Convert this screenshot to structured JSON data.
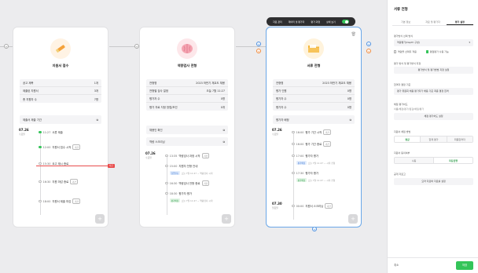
{
  "toolbar": {
    "items": [
      "자료 관리",
      "데이터 및 평가자",
      "평가 과정",
      "상세 보기"
    ],
    "toggle_on": true
  },
  "cards": [
    {
      "title": "지원서 접수",
      "info": [
        {
          "k": "공고 제목",
          "v": "1개"
        },
        {
          "k": "제출된 지원서",
          "v": "3개"
        },
        {
          "k": "총 지원자 수",
          "v": "7명"
        }
      ],
      "button": "제출서 제출 기간",
      "day_date": "07.26",
      "day_wk": "수요일",
      "events": [
        {
          "time": "11:27",
          "text": "서류 제출",
          "tag": "",
          "sub": ""
        },
        {
          "time": "12:00",
          "text": "지원서 접수 시작",
          "tag": "기간",
          "sub": ""
        },
        {
          "time": "15:30",
          "text": "요고 제시 종료",
          "tag": "",
          "sub": ""
        },
        {
          "time": "16:30",
          "text": "지원 마감 종료",
          "tag": "기간",
          "sub": ""
        },
        {
          "time": "18:00",
          "text": "지원서 제출 마감",
          "tag": "기간",
          "sub": ""
        }
      ],
      "red_badge": "지금"
    },
    {
      "title": "역량검사 전형",
      "info": [
        {
          "k": "전형명",
          "v": "2023 하반기 채교도 채용"
        },
        {
          "k": "전형별 검사 일정",
          "v": "오늘 7월 11:27"
        },
        {
          "k": "평가자 수",
          "v": "0명"
        },
        {
          "k": "평가 자료 지정 방법/조건",
          "v": "0개"
        }
      ],
      "buttons": [
        "채용인 확인",
        "역량 스크리닝"
      ],
      "day_date": "07.26",
      "day_wk": "수요일",
      "events": [
        {
          "time": "13:35",
          "text": "역량검사 과정 시작",
          "tag": "기간",
          "tagc": "o",
          "sub": ""
        },
        {
          "time": "15:00",
          "text": "지원자 전형 안내",
          "tag": "",
          "sub": ""
        },
        {
          "time": "",
          "text": "",
          "tag": "영업발표",
          "tagc": "b",
          "sub": "오늘 7월 11:27 ~ 역량검사 시작"
        },
        {
          "time": "16:30",
          "text": "역량검사 전형 종료",
          "tag": "기간",
          "tagc": "o",
          "sub": ""
        },
        {
          "time": "18:30",
          "text": "평가자 평가",
          "tag": "",
          "sub": ""
        },
        {
          "time": "",
          "text": "",
          "tag": "평가배정",
          "tagc": "g",
          "sub": "오늘 7월 11:27 ~ 역량검사 시작"
        }
      ]
    },
    {
      "title": "서류 전형",
      "info": [
        {
          "k": "전형명",
          "v": "2023 하반기 채교도 채용"
        },
        {
          "k": "평가 인원",
          "v": "0명"
        },
        {
          "k": "평가자 수",
          "v": "0명"
        },
        {
          "k": "평가자 수",
          "v": "0명"
        }
      ],
      "button": "평가자 배정",
      "day_date": "07.26",
      "day_wk": "수요일",
      "events": [
        {
          "time": "16:00",
          "text": "평가 기간 시작",
          "tag": "기간",
          "tagc": "o",
          "sub": ""
        },
        {
          "time": "16:00",
          "text": "평가 기간 종료",
          "tag": "기간",
          "tagc": "o",
          "sub": ""
        },
        {
          "time": "17:00",
          "text": "평가자 평가",
          "tag": "",
          "sub": ""
        },
        {
          "time": "",
          "text": "",
          "tag": "평가배정",
          "tagc": "b",
          "sub": "오늘 7월 11:27 ~ 시작 전형"
        },
        {
          "time": "17:30",
          "text": "평가자 평가",
          "tag": "",
          "sub": ""
        },
        {
          "time": "",
          "text": "",
          "tag": "평가배정",
          "tagc": "g",
          "sub": "오늘 7월 11:27 ~ 시작 전형"
        }
      ],
      "day2_date": "07.30",
      "day2_wk": "일요일",
      "event2": {
        "time": "00:00",
        "text": "지원서 스크리닝",
        "tag": "기간",
        "tagc": "o"
      }
    }
  ],
  "panel": {
    "title": "서류 전형",
    "tabs": [
      "기본 정보",
      "자료 및 평가자",
      "평가 설정"
    ],
    "active_tab": 2,
    "eval_type_label": "평가방식 선택 방식",
    "eval_type_value": "역량평가(Depth 구성)",
    "check1": "역량을 선택지 적용",
    "check2": "평점평가 사용 가능",
    "criteria_label": "평가 방식 및 평가방식 지정",
    "criteria_value": "평가방식 및 평가방법 지정 설정",
    "result_label": "합격자 결정 기준",
    "result_value": "평가 위원회 채용 평가자가 채용 기준 최종 결정 합격",
    "score_label": "채점 평가하도",
    "score_desc": "이름/채점/평가/점검/채점/평가",
    "score_value": "채점 평가하도 설정",
    "method_label": "지원서 채점 방법",
    "method_opts": [
      "평균",
      "합계 평가",
      "최종합격자"
    ],
    "method_active": 0,
    "disclose_label": "지원서 동의여부",
    "disclose_opts": [
      "수동",
      "자동진행"
    ],
    "disclose_active": 1,
    "extra_label": "공개 자료고",
    "extra_value": "요약 자료와 자료를 설정",
    "cancel": "취소",
    "save": "저장"
  }
}
